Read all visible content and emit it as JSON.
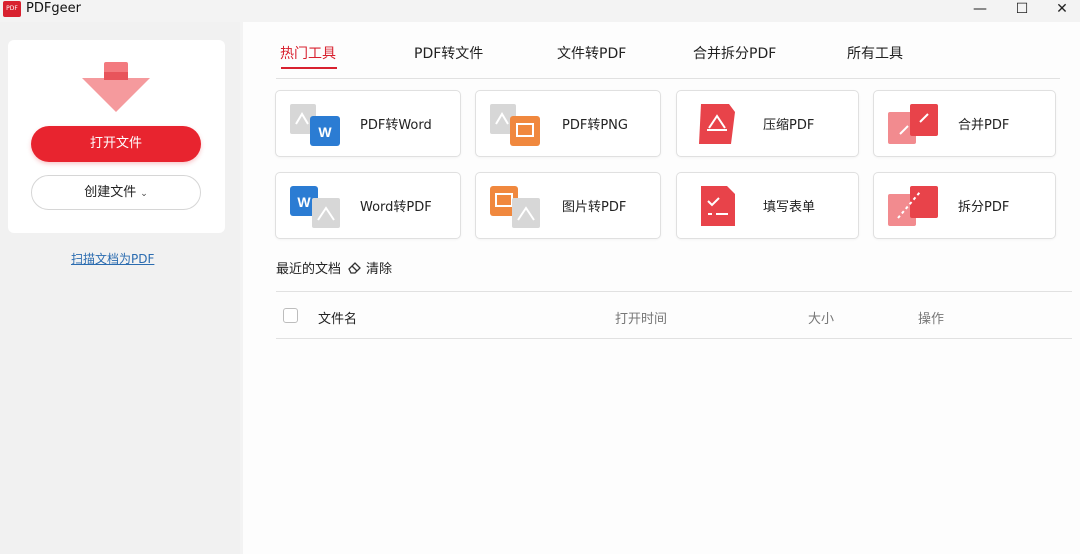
{
  "window": {
    "title": "PDFgeer",
    "logo_text": "PDF",
    "controls": {
      "minimize": "—",
      "maximize": "☐",
      "close": "✕"
    }
  },
  "sidebar": {
    "open_file": "打开文件",
    "create_file": "创建文件",
    "create_chevron": "⌄",
    "scan_link": "扫描文档为PDF"
  },
  "tabs": [
    {
      "label": "热门工具",
      "active": true
    },
    {
      "label": "PDF转文件",
      "active": false
    },
    {
      "label": "文件转PDF",
      "active": false
    },
    {
      "label": "合并拆分PDF",
      "active": false
    },
    {
      "label": "所有工具",
      "active": false
    }
  ],
  "tools": [
    {
      "label": "PDF转Word",
      "icon": "pdf-to-word-icon"
    },
    {
      "label": "PDF转PNG",
      "icon": "pdf-to-png-icon"
    },
    {
      "label": "压缩PDF",
      "icon": "compress-pdf-icon"
    },
    {
      "label": "合并PDF",
      "icon": "merge-pdf-icon"
    },
    {
      "label": "Word转PDF",
      "icon": "word-to-pdf-icon"
    },
    {
      "label": "图片转PDF",
      "icon": "image-to-pdf-icon"
    },
    {
      "label": "填写表单",
      "icon": "fill-form-icon"
    },
    {
      "label": "拆分PDF",
      "icon": "split-pdf-icon"
    }
  ],
  "recent": {
    "title": "最近的文档",
    "clear": "清除",
    "columns": [
      "文件名",
      "打开时间",
      "大小",
      "操作"
    ]
  },
  "colors": {
    "accent": "#d8212f",
    "word_blue": "#2b7cd3",
    "image_orange": "#f0883e"
  }
}
